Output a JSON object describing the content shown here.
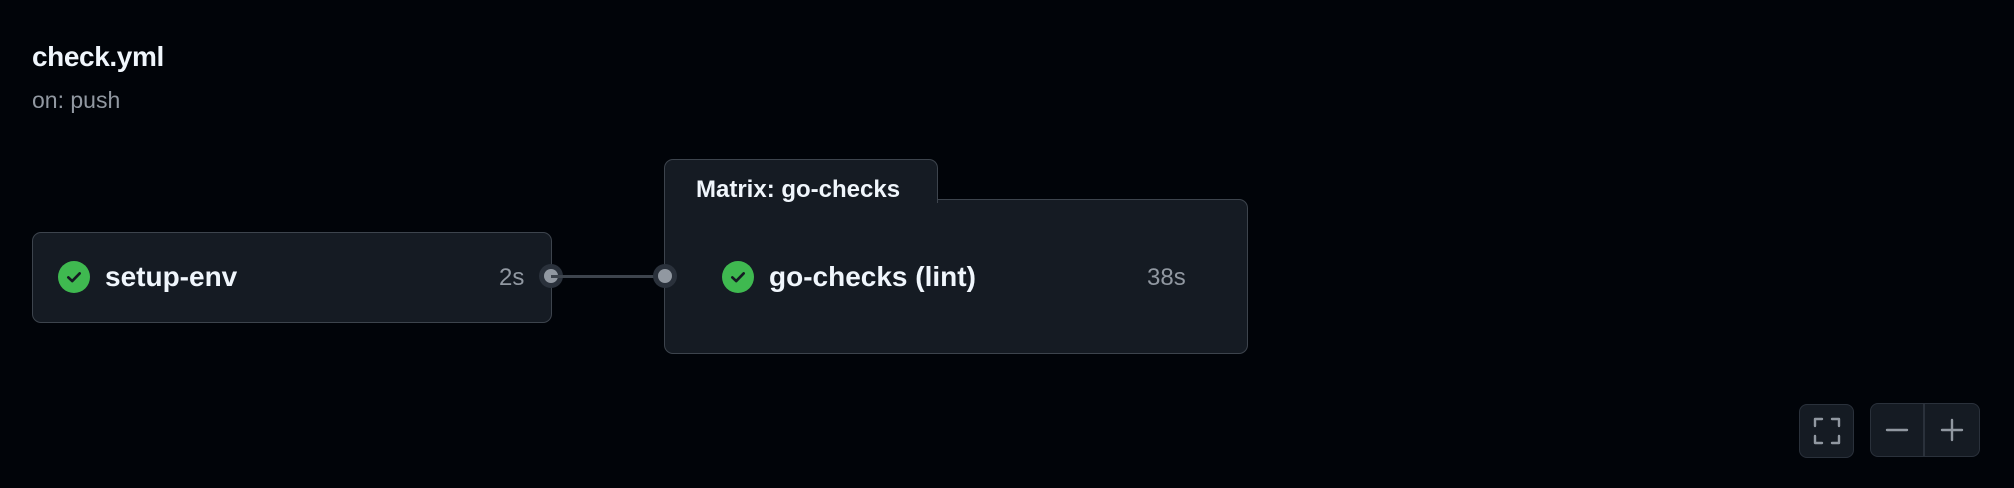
{
  "workflow": {
    "title": "check.yml",
    "trigger": "on: push"
  },
  "jobs": [
    {
      "name": "setup-env",
      "duration": "2s",
      "status": "success",
      "icon": "check-circle-icon"
    },
    {
      "name": "go-checks (lint)",
      "duration": "38s",
      "status": "success",
      "icon": "check-circle-icon"
    }
  ],
  "matrix": {
    "label": "Matrix: go-checks"
  },
  "controls": [
    {
      "name": "fullscreen",
      "icon": "fullscreen-icon"
    },
    {
      "name": "zoom-out",
      "icon": "minus-icon"
    },
    {
      "name": "zoom-in",
      "icon": "plus-icon"
    }
  ],
  "colors": {
    "background": "#010409",
    "node": "#151b23",
    "border": "#3d444d",
    "success": "#3fb950",
    "muted": "#9198a1",
    "text": "#f0f6fc"
  }
}
